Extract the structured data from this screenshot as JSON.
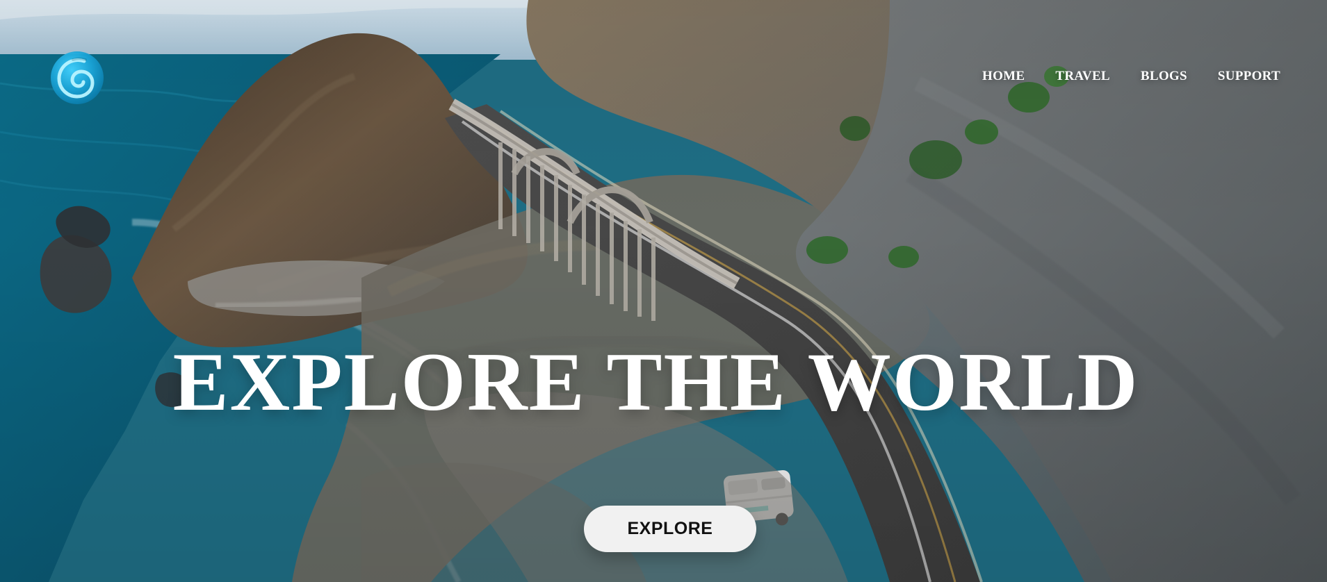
{
  "nav": {
    "items": [
      {
        "label": "HOME"
      },
      {
        "label": "TRAVEL"
      },
      {
        "label": "BLOGS"
      },
      {
        "label": "SUPPORT"
      }
    ]
  },
  "hero": {
    "title": "EXPLORE THE WORLD",
    "cta_label": "EXPLORE"
  },
  "colors": {
    "text": "#ffffff",
    "button_bg": "#f1f1f1",
    "button_text": "#111111",
    "logo_primary": "#1aa3d6"
  },
  "icons": {
    "logo": "swirl-logo-icon"
  }
}
